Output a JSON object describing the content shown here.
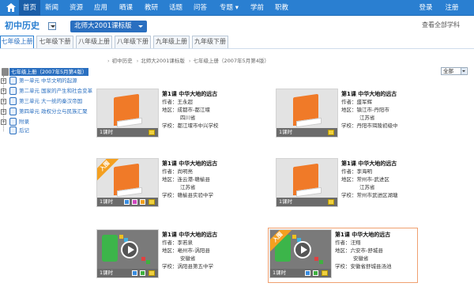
{
  "nav": {
    "items": [
      {
        "label": "首页",
        "active": true
      },
      {
        "label": "新闻"
      },
      {
        "label": "资源"
      },
      {
        "label": "应用"
      },
      {
        "label": "晒课"
      },
      {
        "label": "教研"
      },
      {
        "label": "话题"
      },
      {
        "label": "问答"
      },
      {
        "label": "专题 ▾"
      },
      {
        "label": "学前"
      },
      {
        "label": "职教"
      }
    ],
    "login": "登录",
    "logout": "注册"
  },
  "subject": {
    "name": "初中历史",
    "edition": "北师大2001课标版",
    "all_link": "查看全部学科"
  },
  "grade_tabs": [
    "七年级上册",
    "七年级下册",
    "八年级上册",
    "八年级下册",
    "九年级上册",
    "九年级下册"
  ],
  "sidebar": {
    "root": "七年级上册（2007年5月第4版）",
    "items": [
      "第一单元  中华文明的起源",
      "第二单元  国家的产生和社会变革",
      "第三单元  大一统的秦汉帝国",
      "第四单元  政权分立与民族汇聚",
      "附录",
      "后记"
    ]
  },
  "breadcrumb": [
    "初中历史",
    "北师大2001课标版",
    "七年级上册（2007年5月第4版）"
  ],
  "filter": {
    "selected": "全部"
  },
  "cards": [
    {
      "title": "第1课  中华大地的远古",
      "author": "作者：王永超",
      "region": [
        "地区：成都市-都江堰",
        "四川省"
      ],
      "school": "学校：都江堰市中兴学校",
      "hours": "1课时",
      "kind": "book",
      "ribbon": ""
    },
    {
      "title": "第1课  中华大地的远古",
      "author": "作者：盛军辉",
      "region": [
        "地区：镇江市-丹阳市",
        "江苏省"
      ],
      "school": "学校：丹阳市珥陵初级中",
      "hours": "1课时",
      "kind": "book",
      "ribbon": ""
    },
    {
      "title": "第1课  中华大地的远古",
      "author": "作者：尚明亮",
      "region": [
        "地区：连云港-赣榆县",
        "江苏省"
      ],
      "school": "学校：赣榆县实验中学",
      "hours": "1课时",
      "kind": "ribbon",
      "ribbon": "入围"
    },
    {
      "title": "第1课  中华大地的远古",
      "author": "作者：李海明",
      "region": [
        "地区：常州市-武进区",
        "江苏省"
      ],
      "school": "学校：常州市武进区湖塘",
      "hours": "1课时",
      "kind": "book",
      "ribbon": ""
    },
    {
      "title": "第1课  中华大地的远古",
      "author": "作者：李若泉",
      "region": [
        "地区：亳州市-涡阳县",
        "安徽省"
      ],
      "school": "学校：涡阳县第五中学",
      "hours": "1课时",
      "kind": "video",
      "ribbon": ""
    },
    {
      "title": "第1课  中华大地的远古",
      "author": "作者：汪翔",
      "region": [
        "地区：六安市-舒城县",
        "安徽省"
      ],
      "school": "学校：安徽省舒城县汤池",
      "hours": "1课时",
      "kind": "video",
      "ribbon": "入围"
    }
  ]
}
